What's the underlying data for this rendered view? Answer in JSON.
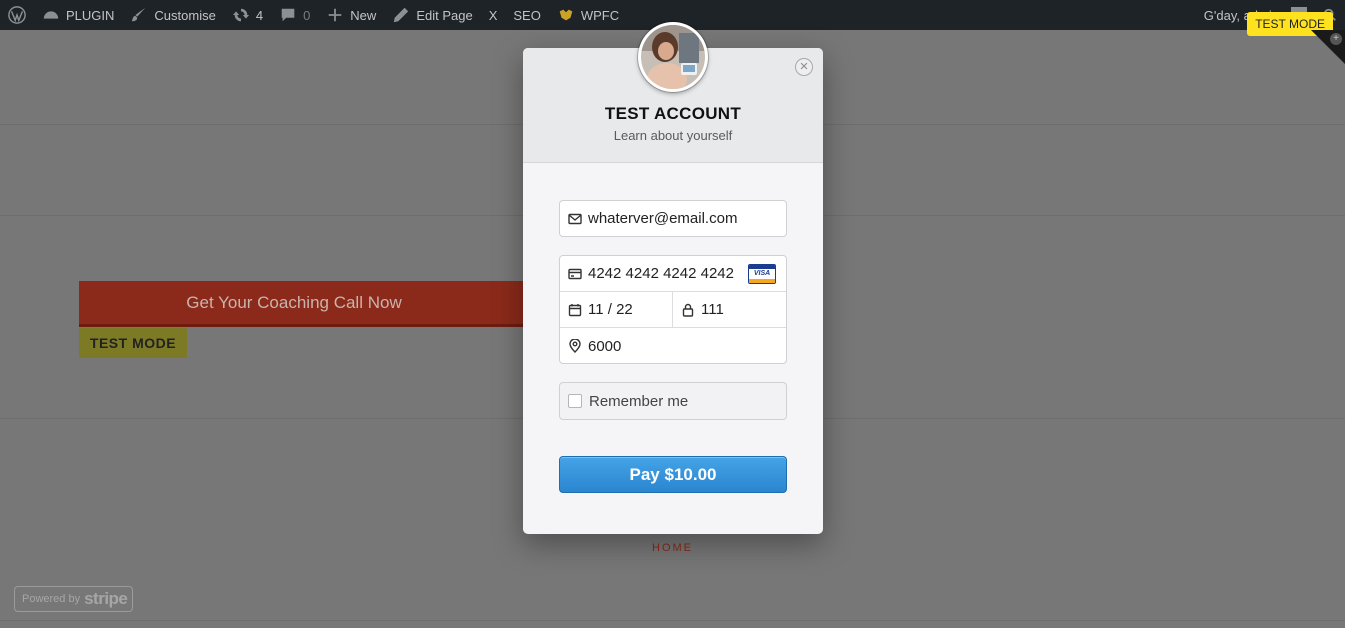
{
  "adminbar": {
    "site_name": "PLUGIN",
    "customise": "Customise",
    "updates_count": "4",
    "comments_count": "0",
    "new_label": "New",
    "edit_page": "Edit Page",
    "x_label": "X",
    "seo_label": "SEO",
    "wpfc_label": "WPFC",
    "greeting": "G'day, admin"
  },
  "test_mode_pill": "TEST MODE",
  "page": {
    "cta_label": "Get Your Coaching Call Now",
    "test_mode_badge": "TEST MODE",
    "home_link": "HOME",
    "powered_by": "Powered by",
    "powered_brand": "stripe"
  },
  "checkout": {
    "title": "TEST ACCOUNT",
    "subtitle": "Learn about yourself",
    "email": "whaterver@email.com",
    "card_number": "4242 4242 4242 4242",
    "card_brand": "VISA",
    "expiry": "11 / 22",
    "cvc": "111",
    "zip": "6000",
    "remember_label": "Remember me",
    "pay_label": "Pay $10.00",
    "close_symbol": "×"
  },
  "colors": {
    "adminbar_bg": "#1d2327",
    "pay_button": "#2a86d0",
    "test_mode": "#ffe21f",
    "cta_bg": "#8b2a1a"
  }
}
